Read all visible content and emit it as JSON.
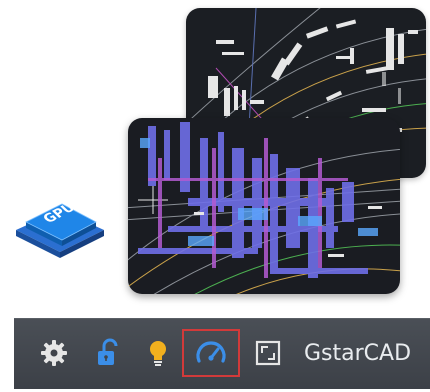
{
  "gpu_badge": {
    "label": "GPU",
    "colors": {
      "face": "#1f86e8",
      "side": "#0f5fb0",
      "base": "#2b6fd1"
    }
  },
  "preview_images": [
    {
      "name": "cad-drawing-back",
      "background": "#1b1e23"
    },
    {
      "name": "cad-drawing-front",
      "background": "#1a1c22"
    }
  ],
  "status_bar": {
    "background": "#40444b",
    "icons": [
      {
        "name": "gear-icon",
        "color": "#e6e6e6"
      },
      {
        "name": "unlock-icon",
        "color": "#3b8ee8"
      },
      {
        "name": "lightbulb-icon",
        "color": "#f2b01e"
      },
      {
        "name": "performance-gauge-icon",
        "color": "#3b8ee8",
        "highlighted": true,
        "highlight_color": "#d23a3a"
      },
      {
        "name": "fullscreen-icon",
        "color": "#e6e6e6"
      }
    ],
    "brand": "GstarCAD"
  }
}
